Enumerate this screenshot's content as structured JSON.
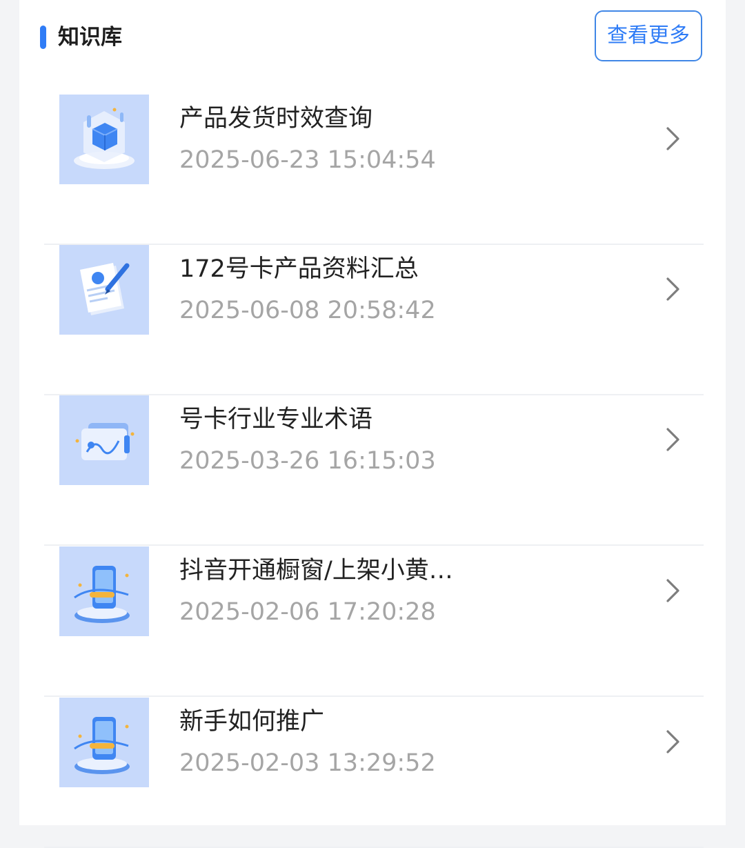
{
  "section": {
    "title": "知识库",
    "more_label": "查看更多",
    "accent_color": "#2f7cf6"
  },
  "items": [
    {
      "title": "产品发货时效查询",
      "date": "2025-06-23 15:04:54",
      "icon": "cube-platform-icon"
    },
    {
      "title": "172号卡产品资料汇总",
      "date": "2025-06-08 20:58:42",
      "icon": "document-pen-icon"
    },
    {
      "title": "号卡行业专业术语",
      "date": "2025-03-26 16:15:03",
      "icon": "chart-card-icon"
    },
    {
      "title": "抖音开通橱窗/上架小黄…",
      "date": "2025-02-06 17:20:28",
      "icon": "phone-podium-icon"
    },
    {
      "title": "新手如何推广",
      "date": "2025-02-03 13:29:52",
      "icon": "phone-podium-icon"
    }
  ]
}
